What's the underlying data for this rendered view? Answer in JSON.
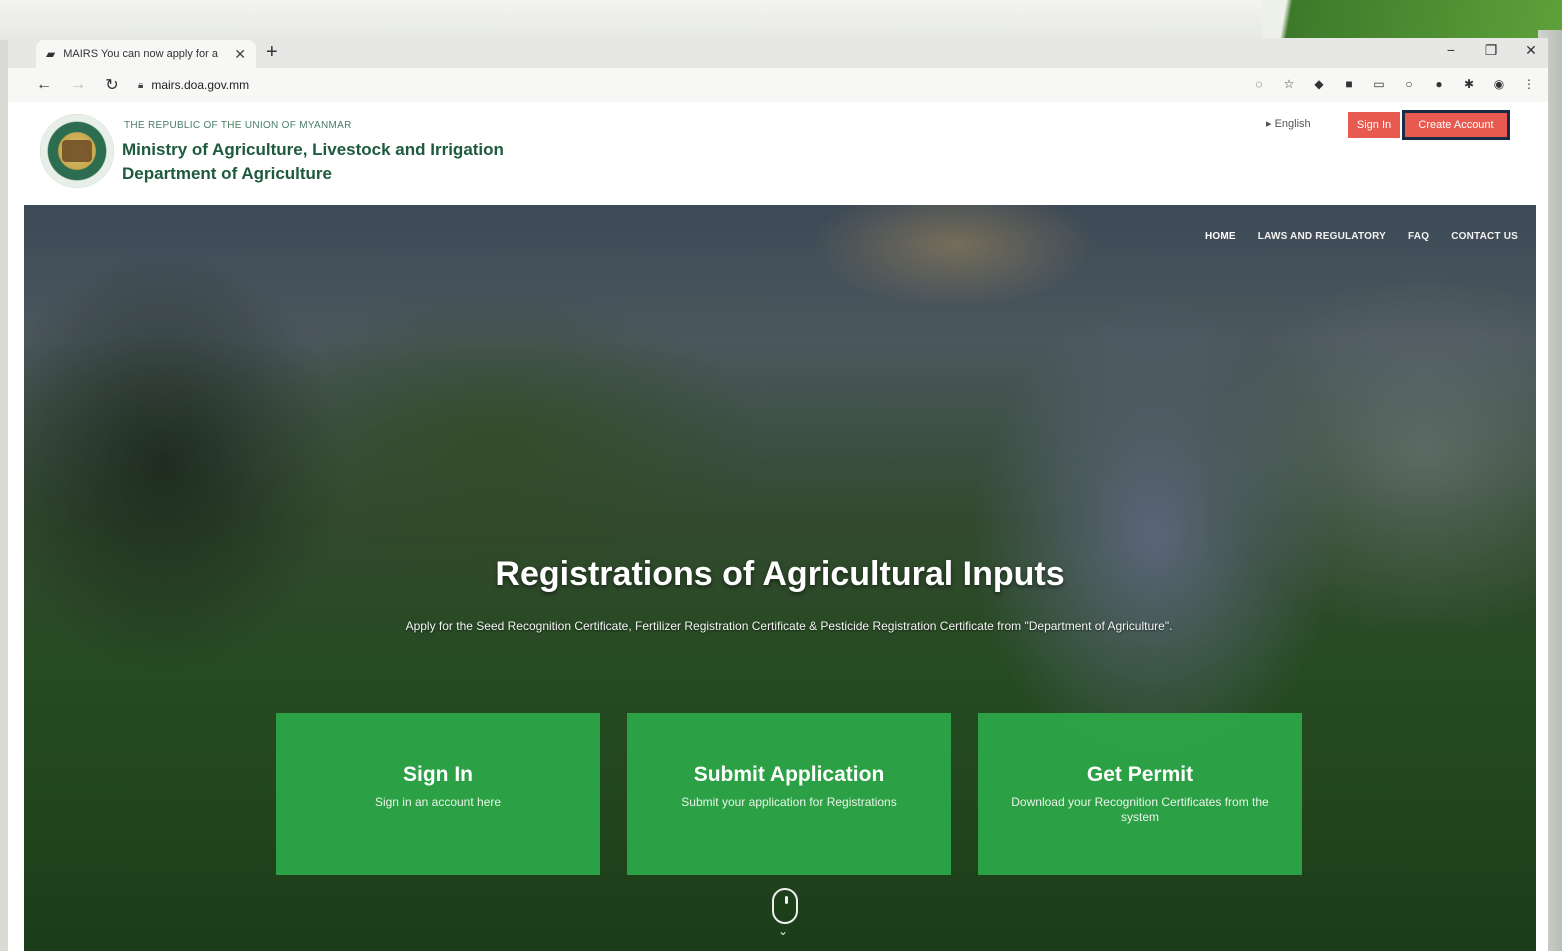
{
  "browser": {
    "tab_title": "MAIRS You can now apply for a",
    "url": "mairs.doa.gov.mm"
  },
  "header": {
    "republic": "THE REPUBLIC OF THE UNION OF MYANMAR",
    "ministry": "Ministry of Agriculture, Livestock and Irrigation",
    "department": "Department of Agriculture",
    "language": "English",
    "signin_label": "Sign In",
    "create_account_label": "Create Account"
  },
  "nav": [
    {
      "label": "HOME",
      "active": true
    },
    {
      "label": "LAWS AND REGULATORY",
      "active": false
    },
    {
      "label": "FAQ",
      "active": false
    },
    {
      "label": "CONTACT US",
      "active": false
    }
  ],
  "hero": {
    "title": "Registrations of Agricultural Inputs",
    "subtitle": "Apply for the Seed Recognition Certificate, Fertilizer Registration Certificate & Pesticide Registration Certificate from \"Department of Agriculture\"."
  },
  "cards": [
    {
      "title": "Sign In",
      "desc": "Sign in an account here"
    },
    {
      "title": "Submit Application",
      "desc": "Submit your application for Registrations"
    },
    {
      "title": "Get Permit",
      "desc": "Download your Recognition Certificates from the system"
    }
  ],
  "colors": {
    "brand_green": "#1d5a3e",
    "card_green": "#2da848",
    "button_red": "#e85a4f"
  }
}
